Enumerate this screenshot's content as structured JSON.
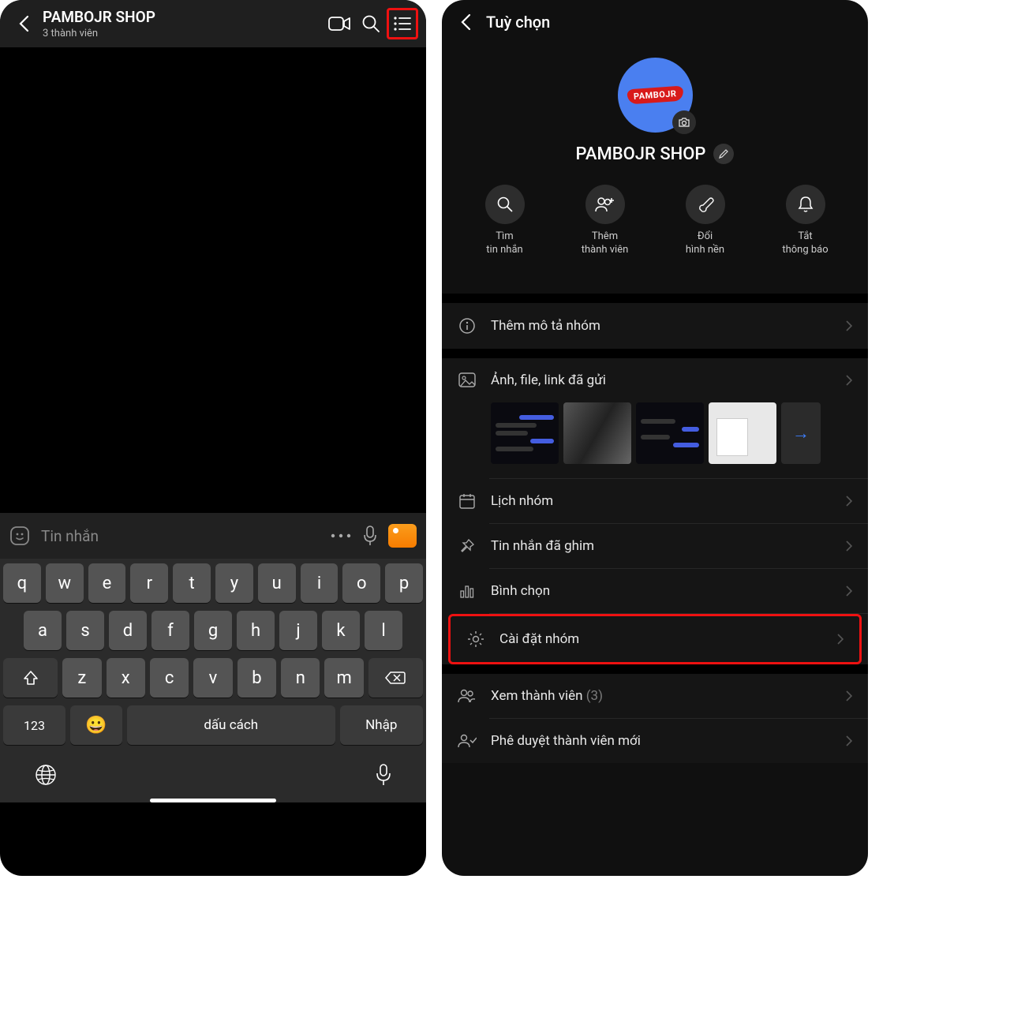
{
  "left": {
    "title": "PAMBOJR SHOP",
    "subtitle": "3 thành viên",
    "input_placeholder": "Tin nhắn",
    "keyboard": {
      "row1": [
        "q",
        "w",
        "e",
        "r",
        "t",
        "y",
        "u",
        "i",
        "o",
        "p"
      ],
      "row2": [
        "a",
        "s",
        "d",
        "f",
        "g",
        "h",
        "j",
        "k",
        "l"
      ],
      "row3": [
        "z",
        "x",
        "c",
        "v",
        "b",
        "n",
        "m"
      ],
      "num_key": "123",
      "space": "dấu cách",
      "enter": "Nhập"
    }
  },
  "right": {
    "header": "Tuỳ chọn",
    "avatar_text": "PAMBOJR",
    "group_name": "PAMBOJR SHOP",
    "actions": {
      "search_l1": "Tìm",
      "search_l2": "tin nhắn",
      "add_l1": "Thêm",
      "add_l2": "thành viên",
      "bg_l1": "Đổi",
      "bg_l2": "hình nền",
      "mute_l1": "Tắt",
      "mute_l2": "thông báo"
    },
    "items": {
      "add_desc": "Thêm mô tả nhóm",
      "media": "Ảnh, file, link đã gửi",
      "calendar": "Lịch nhóm",
      "pinned": "Tin nhắn đã ghim",
      "poll": "Bình chọn",
      "settings": "Cài đặt nhóm",
      "members": "Xem thành viên",
      "members_count": "(3)",
      "approve": "Phê duyệt thành viên mới"
    }
  }
}
